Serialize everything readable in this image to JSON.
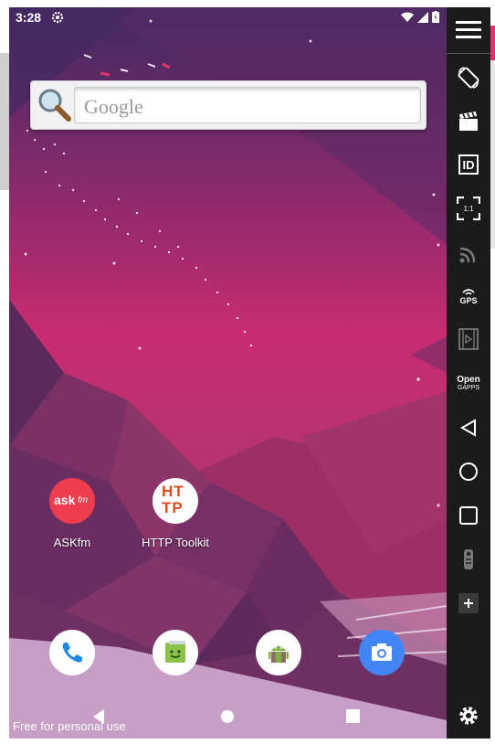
{
  "status_bar": {
    "time": "3:28"
  },
  "search_widget": {
    "placeholder": "Google"
  },
  "apps": [
    {
      "label": "ASKfm",
      "icon_text": "ask",
      "icon_sub": "fm",
      "color": "#ef3b4e"
    },
    {
      "label": "HTTP Toolkit",
      "icon_text_top": "HT",
      "icon_text_bottom": "TP",
      "color": "#ffffff",
      "text_color": "#e2491b"
    }
  ],
  "dock": [
    {
      "icon": "phone-icon"
    },
    {
      "icon": "messaging-icon"
    },
    {
      "icon": "android-package-icon"
    },
    {
      "icon": "camera-icon"
    }
  ],
  "watermark": "Free for personal use",
  "sidebar": {
    "gps_label": "GPS",
    "open_label": "Open",
    "gapps_label": "GAPPS",
    "id_label": "ID",
    "ratio_label": "1:1"
  },
  "colors": {
    "accent": "#e0336e",
    "sidebar_bg": "#1b1b1b"
  }
}
